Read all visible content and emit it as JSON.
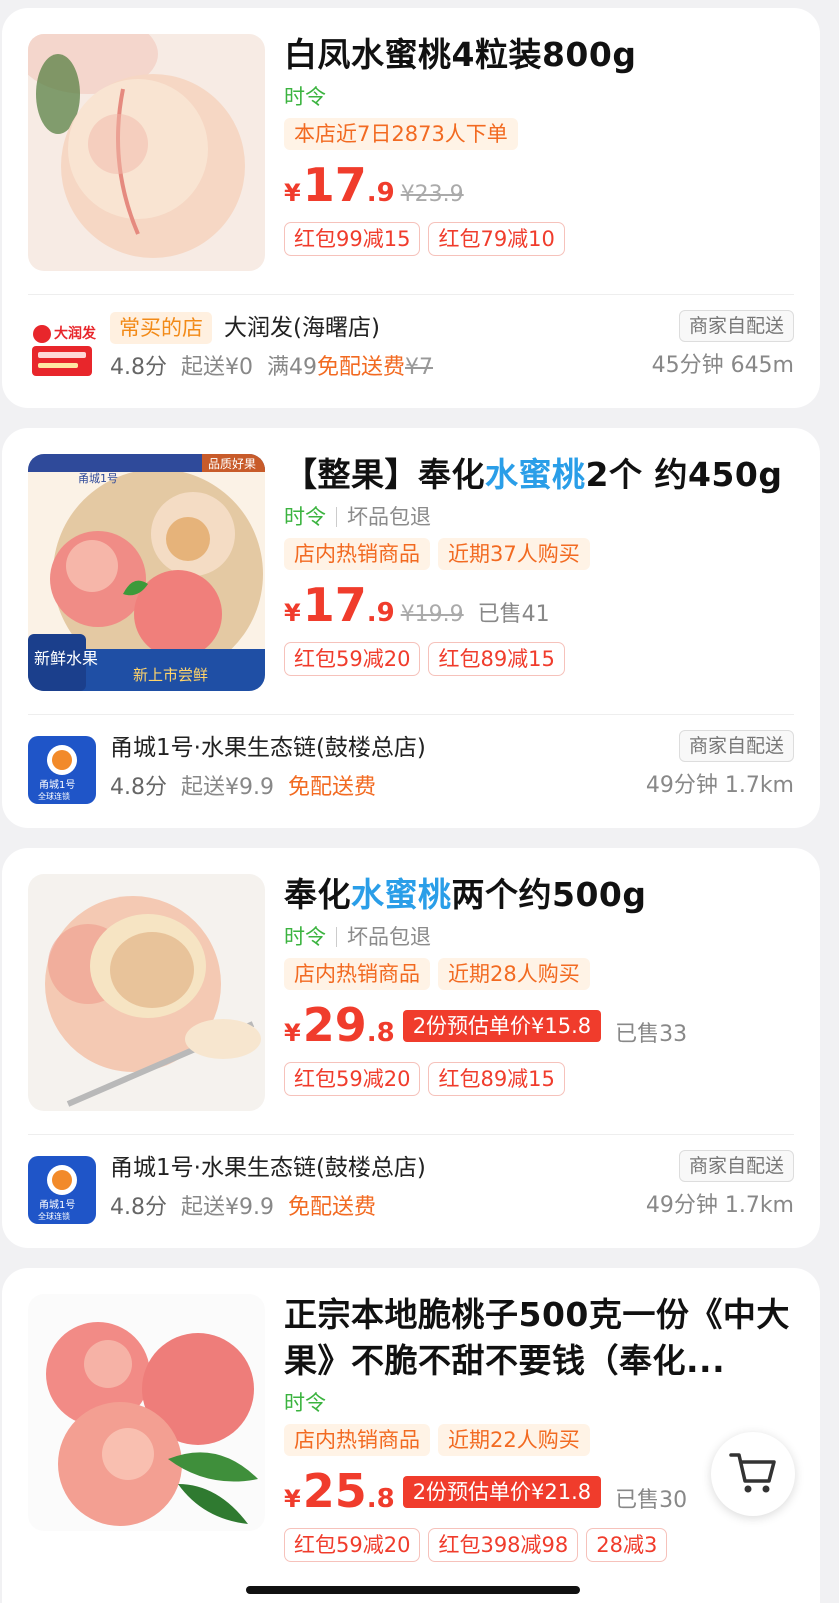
{
  "products": [
    {
      "title": "白凤水蜜桃4粒装800g",
      "tag_green": "时令",
      "orange_tags": [
        "本店近7日2873人下单"
      ],
      "price_int": "17",
      "price_dec": ".9",
      "orig_price": "¥23.9",
      "coupons": [
        "红包99减15",
        "红包79减10"
      ],
      "store": {
        "often_tag": "常买的店",
        "name": "大润发(海曙店)",
        "score": "4.8分",
        "min_order": "起送¥0",
        "fee_prefix": "满49",
        "fee_text": "免配送费",
        "fee_orig": "¥7",
        "delivery": "商家自配送",
        "eta": "45分钟 645m",
        "logo_text": "大润发"
      }
    },
    {
      "title_pre": "【整果】奉化",
      "title_hl": "水蜜桃",
      "title_post": "2个 约450g",
      "tag_green": "时令",
      "tag_gray": "坏品包退",
      "orange_tags": [
        "店内热销商品",
        "近期37人购买"
      ],
      "price_int": "17",
      "price_dec": ".9",
      "orig_price": "¥19.9",
      "sold": "已售41",
      "coupons": [
        "红包59减20",
        "红包89减15"
      ],
      "badge_text": "品质好果",
      "brand_text": "甬城1号",
      "corner_text": "新鲜水果",
      "bottom_text": "新上市尝鲜",
      "store": {
        "name": "甬城1号·水果生态链(鼓楼总店)",
        "score": "4.8分",
        "min_order": "起送¥9.9",
        "fee_text": "免配送费",
        "delivery": "商家自配送",
        "eta": "49分钟 1.7km",
        "logo_text": "甬城1号",
        "logo_sub": "全球连锁"
      }
    },
    {
      "title_pre": "奉化",
      "title_hl": "水蜜桃",
      "title_post": "两个约500g",
      "tag_green": "时令",
      "tag_gray": "坏品包退",
      "orange_tags": [
        "店内热销商品",
        "近期28人购买"
      ],
      "price_int": "29",
      "price_dec": ".8",
      "est_price": "2份预估单价¥15.8",
      "sold": "已售33",
      "coupons": [
        "红包59减20",
        "红包89减15"
      ],
      "store": {
        "name": "甬城1号·水果生态链(鼓楼总店)",
        "score": "4.8分",
        "min_order": "起送¥9.9",
        "fee_text": "免配送费",
        "delivery": "商家自配送",
        "eta": "49分钟 1.7km",
        "logo_text": "甬城1号",
        "logo_sub": "全球连锁"
      }
    },
    {
      "title": "正宗本地脆桃子500克一份《中大果》不脆不甜不要钱（奉化...",
      "tag_green": "时令",
      "orange_tags": [
        "店内热销商品",
        "近期22人购买"
      ],
      "price_int": "25",
      "price_dec": ".8",
      "est_price": "2份预估单价¥21.8",
      "sold": "已售30",
      "coupons": [
        "红包59减20",
        "红包398减98",
        "28减3"
      ]
    }
  ],
  "currency": "¥",
  "colors": {
    "price": "#f03c2c",
    "highlight": "#2a9ee8",
    "green": "#3bb33f",
    "orange": "#f26a21"
  }
}
